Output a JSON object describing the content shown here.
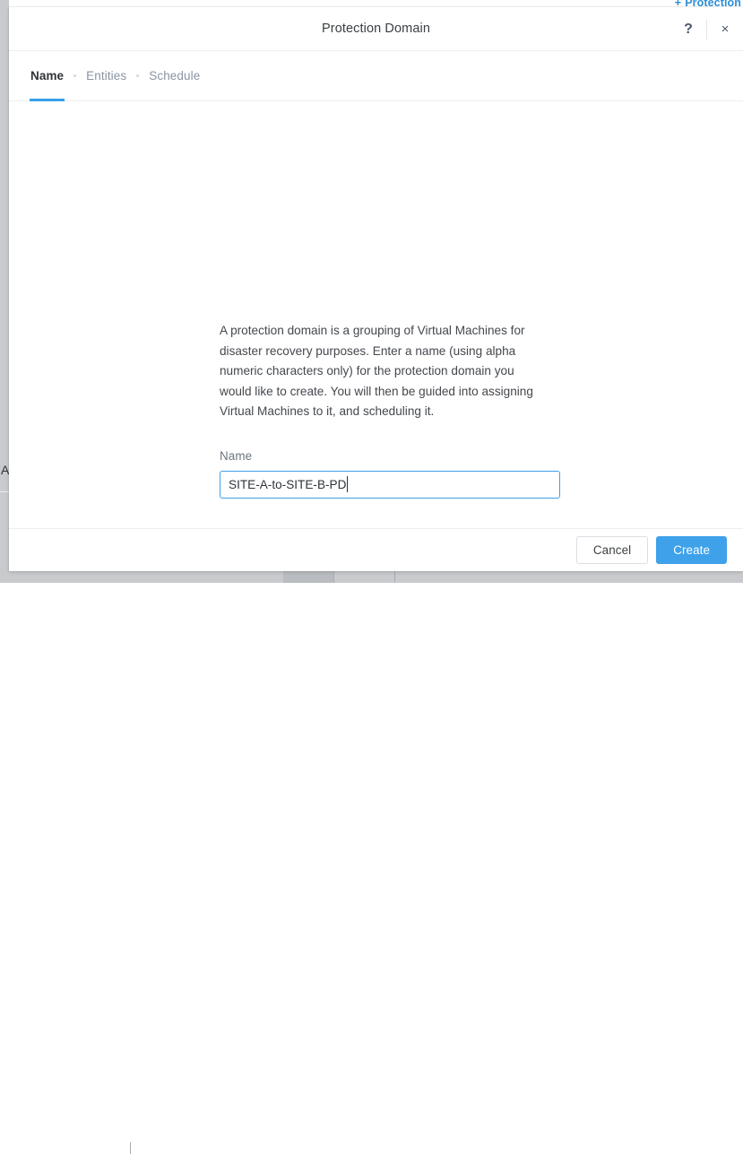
{
  "background": {
    "protection_link": {
      "icon": "plus-icon",
      "plus": "+",
      "label": "Protection"
    },
    "stray_letter": "A"
  },
  "modal": {
    "title": "Protection Domain",
    "header_actions": [
      {
        "name": "help-icon",
        "glyph": "?"
      },
      {
        "name": "close-icon",
        "glyph": "×"
      }
    ],
    "tabs": [
      {
        "label": "Name",
        "active": true
      },
      {
        "label": "Entities",
        "active": false
      },
      {
        "label": "Schedule",
        "active": false
      }
    ],
    "body": {
      "intro_text": "A protection domain is a grouping of Virtual Machines for disaster recovery purposes. Enter a name (using alpha numeric characters only) for the protection domain you would like to create. You will then be guided into assigning Virtual Machines to it, and scheduling it.",
      "name_field": {
        "label": "Name",
        "value": "SITE-A-to-SITE-B-PD",
        "placeholder": "",
        "focused": true
      }
    },
    "footer": {
      "cancel_label": "Cancel",
      "create_label": "Create"
    }
  },
  "colors": {
    "accent_blue": "#3ea1ea",
    "tab_active_underline": "#36a0e8",
    "input_focus_border": "#3fa0e9",
    "link_blue": "#2d8fd5",
    "text_primary": "#2e3338",
    "text_secondary": "#6d7480",
    "tab_inactive": "#8b94a3",
    "border_light": "#eceef0",
    "chrome_gray": "#c8cacd"
  }
}
